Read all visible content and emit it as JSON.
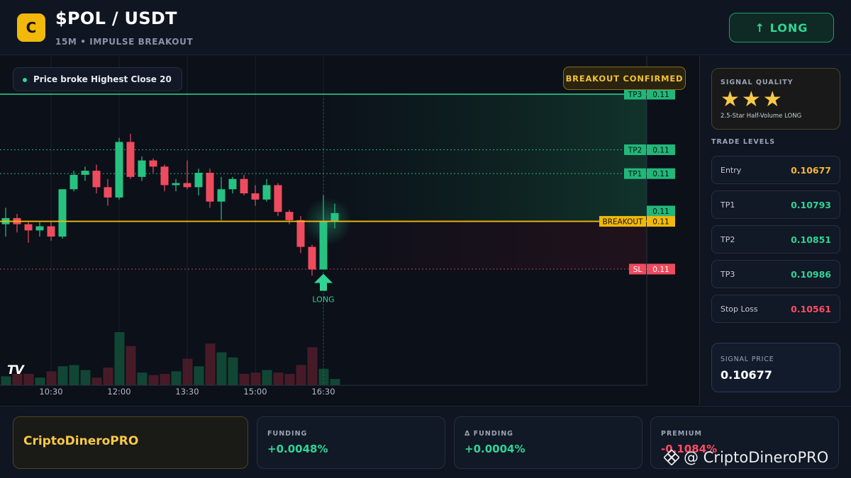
{
  "header": {
    "logo_letter": "C",
    "title": "$POL / USDT",
    "subtitle": "15M • IMPULSE BREAKOUT",
    "long_button": "↑ LONG"
  },
  "chart": {
    "pill_text": "Price broke Highest Close 20",
    "confirm_badge": "BREAKOUT CONFIRMED",
    "tv_logo": "TV",
    "long_marker": "LONG",
    "time_labels": [
      "10:30",
      "12:00",
      "13:30",
      "15:00",
      "16:30"
    ],
    "level_tags": {
      "tp3": {
        "name": "TP3",
        "value": "0.11"
      },
      "tp2": {
        "name": "TP2",
        "value": "0.11"
      },
      "tp1": {
        "name": "TP1",
        "value": "0.11"
      },
      "current": {
        "value": "0.11"
      },
      "breakout": {
        "name": "BREAKOUT",
        "value": "0.11"
      },
      "sl": {
        "name": "SL",
        "value": "0.11"
      },
      "top_faint": "0.11"
    },
    "colors": {
      "up": "#26c281",
      "down": "#ef4b5f",
      "breakout": "#f0b90b",
      "tp": "#2fd594",
      "sl": "#ef4b5f"
    }
  },
  "chart_data": {
    "type": "candlestick",
    "x_ticks": [
      "10:30",
      "12:00",
      "13:30",
      "15:00",
      "16:30"
    ],
    "candles": [
      {
        "o": 0.1067,
        "h": 0.1071,
        "l": 0.1064,
        "c": 0.10685,
        "v": 0.7
      },
      {
        "o": 0.10685,
        "h": 0.10695,
        "l": 0.1065,
        "c": 0.1067,
        "v": 0.9
      },
      {
        "o": 0.1067,
        "h": 0.10675,
        "l": 0.10625,
        "c": 0.10655,
        "v": 0.9
      },
      {
        "o": 0.10655,
        "h": 0.10675,
        "l": 0.1064,
        "c": 0.10665,
        "v": 0.6
      },
      {
        "o": 0.10665,
        "h": 0.10675,
        "l": 0.1063,
        "c": 0.1064,
        "v": 1.1
      },
      {
        "o": 0.1064,
        "h": 0.10755,
        "l": 0.10635,
        "c": 0.10755,
        "v": 1.5
      },
      {
        "o": 0.10755,
        "h": 0.108,
        "l": 0.1075,
        "c": 0.1079,
        "v": 1.6
      },
      {
        "o": 0.1079,
        "h": 0.1081,
        "l": 0.10775,
        "c": 0.108,
        "v": 1.2
      },
      {
        "o": 0.108,
        "h": 0.10815,
        "l": 0.10745,
        "c": 0.1076,
        "v": 0.6
      },
      {
        "o": 0.1076,
        "h": 0.1078,
        "l": 0.10715,
        "c": 0.10735,
        "v": 1.4
      },
      {
        "o": 0.10735,
        "h": 0.1088,
        "l": 0.1073,
        "c": 0.1087,
        "v": 4.2
      },
      {
        "o": 0.1087,
        "h": 0.1089,
        "l": 0.1078,
        "c": 0.10785,
        "v": 3.1
      },
      {
        "o": 0.10785,
        "h": 0.10835,
        "l": 0.10775,
        "c": 0.10825,
        "v": 1.0
      },
      {
        "o": 0.10825,
        "h": 0.1083,
        "l": 0.10795,
        "c": 0.1081,
        "v": 0.8
      },
      {
        "o": 0.1081,
        "h": 0.10815,
        "l": 0.1075,
        "c": 0.10765,
        "v": 0.9
      },
      {
        "o": 0.10765,
        "h": 0.1078,
        "l": 0.1075,
        "c": 0.1077,
        "v": 1.1
      },
      {
        "o": 0.1077,
        "h": 0.10825,
        "l": 0.10755,
        "c": 0.1076,
        "v": 2.1
      },
      {
        "o": 0.1076,
        "h": 0.10805,
        "l": 0.1074,
        "c": 0.10795,
        "v": 1.5
      },
      {
        "o": 0.10795,
        "h": 0.10805,
        "l": 0.1071,
        "c": 0.10725,
        "v": 3.3
      },
      {
        "o": 0.10725,
        "h": 0.10785,
        "l": 0.1068,
        "c": 0.10755,
        "v": 2.6
      },
      {
        "o": 0.10755,
        "h": 0.10785,
        "l": 0.10745,
        "c": 0.1078,
        "v": 2.2
      },
      {
        "o": 0.1078,
        "h": 0.1079,
        "l": 0.1074,
        "c": 0.10745,
        "v": 0.9
      },
      {
        "o": 0.10745,
        "h": 0.10765,
        "l": 0.10715,
        "c": 0.1073,
        "v": 1.0
      },
      {
        "o": 0.1073,
        "h": 0.1078,
        "l": 0.10725,
        "c": 0.10765,
        "v": 1.2
      },
      {
        "o": 0.10765,
        "h": 0.1077,
        "l": 0.1069,
        "c": 0.107,
        "v": 1.0
      },
      {
        "o": 0.107,
        "h": 0.10705,
        "l": 0.1067,
        "c": 0.1068,
        "v": 0.9
      },
      {
        "o": 0.1068,
        "h": 0.1069,
        "l": 0.106,
        "c": 0.10615,
        "v": 1.6
      },
      {
        "o": 0.10615,
        "h": 0.1062,
        "l": 0.10545,
        "c": 0.1056,
        "v": 3.0
      },
      {
        "o": 0.1056,
        "h": 0.1074,
        "l": 0.1056,
        "c": 0.10677,
        "v": 1.3
      },
      {
        "o": 0.10677,
        "h": 0.1072,
        "l": 0.1066,
        "c": 0.10697,
        "v": 0.5
      }
    ],
    "levels": {
      "tp3": 0.10986,
      "tp2": 0.10851,
      "tp1": 0.10793,
      "breakout": 0.10677,
      "sl": 0.10561
    },
    "signal_index": 28
  },
  "side": {
    "quality_title": "SIGNAL QUALITY",
    "stars": "★★★",
    "quality_desc": "2.5-Star Half-Volume LONG",
    "levels_title": "TRADE LEVELS",
    "levels": [
      {
        "label": "Entry",
        "value": "0.10677",
        "color": "#f5b731"
      },
      {
        "label": "TP1",
        "value": "0.10793",
        "color": "#2fd594"
      },
      {
        "label": "TP2",
        "value": "0.10851",
        "color": "#2fd594"
      },
      {
        "label": "TP3",
        "value": "0.10986",
        "color": "#2fd594"
      },
      {
        "label": "Stop Loss",
        "value": "0.10561",
        "color": "#ff4d64"
      }
    ],
    "price_title": "SIGNAL PRICE",
    "price_value": "0.10677"
  },
  "footer": {
    "brand": "CriptoDineroPRO",
    "funding_label": "FUNDING",
    "funding_value": "+0.0048%",
    "delta_label": "Δ FUNDING",
    "delta_value": "+0.0004%",
    "premium_label": "PREMIUM",
    "premium_value": "-0.1084%",
    "watermark": "@ CriptoDineroPRO"
  }
}
